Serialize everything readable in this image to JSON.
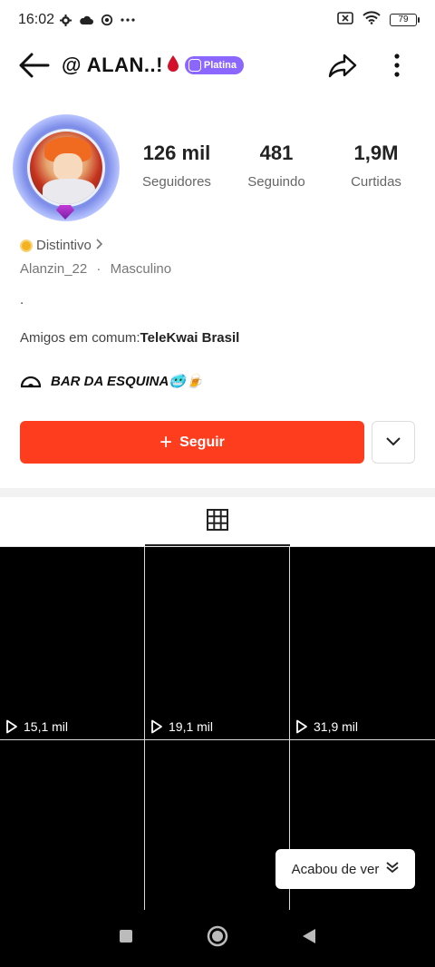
{
  "status_bar": {
    "time": "16:02",
    "battery": "79",
    "icons": [
      "gear-icon",
      "cloud-icon",
      "sync-icon",
      "more-dots-icon",
      "sim-off-icon",
      "wifi-icon",
      "battery-icon"
    ]
  },
  "header": {
    "title": "@ ALAN..!",
    "badge": "Platina"
  },
  "profile": {
    "stats": [
      {
        "value": "126 mil",
        "label": "Seguidores"
      },
      {
        "value": "481",
        "label": "Seguindo"
      },
      {
        "value": "1,9M",
        "label": "Curtidas"
      }
    ],
    "distintivo": "Distintivo",
    "username": "Alanzin_22",
    "gender": "Masculino",
    "bio": ".",
    "amigos_prefix": "Amigos em comum:",
    "amigos_name": "TeleKwai Brasil",
    "tag_text": "BAR DA ESQUINA🥶🍺"
  },
  "actions": {
    "follow_label": "Seguir"
  },
  "videos": [
    {
      "views": "15,1 mil"
    },
    {
      "views": "19,1 mil"
    },
    {
      "views": "31,9 mil"
    }
  ],
  "toast": {
    "label": "Acabou de ver"
  },
  "colors": {
    "accent": "#fe3c1e",
    "badge": "#8b67ff"
  }
}
